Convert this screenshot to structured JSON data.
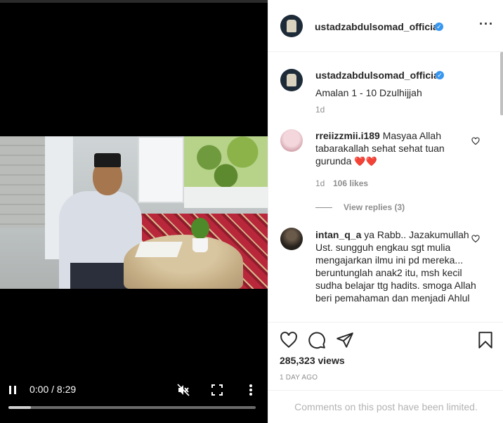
{
  "post": {
    "username": "ustadzabdulsomad_official",
    "caption": "Amalan 1 - 10 Dzulhijjah",
    "caption_time": "1d",
    "views": "285,323 views",
    "time_ago": "1 DAY AGO",
    "comments_limited": "Comments on this post have been limited."
  },
  "video": {
    "time": "0:00 / 8:29",
    "progress": 0.09
  },
  "comments": [
    {
      "username": "rreiizzmii.i189",
      "text": " Masyaa Allah tabarakallah sehat sehat tuan gurunda",
      "emoji": "❤️❤️",
      "time": "1d",
      "likes": "106 likes",
      "view_replies": "View replies (3)"
    },
    {
      "username": "intan_q_a",
      "text": " ya Rabb.. Jazakumullah Ust. sungguh engkau sgt mulia mengajarkan ilmu ini pd mereka... beruntunglah anak2 itu, msh kecil sudha belajar ttg hadits. smoga Allah beri pemahaman dan menjadi Ahlul"
    }
  ],
  "icons": {
    "verified": "verified-badge-icon",
    "more": "more-options-icon",
    "like": "heart-icon",
    "comment": "comment-icon",
    "share": "share-icon",
    "save": "bookmark-icon",
    "play": "pause-icon",
    "mute": "mute-icon",
    "fullscreen": "fullscreen-icon",
    "video_more": "vertical-dots-icon"
  },
  "colors": {
    "verified": "#3897f0",
    "muted_text": "#8e8e8e",
    "heart_red": "#ed4956"
  }
}
